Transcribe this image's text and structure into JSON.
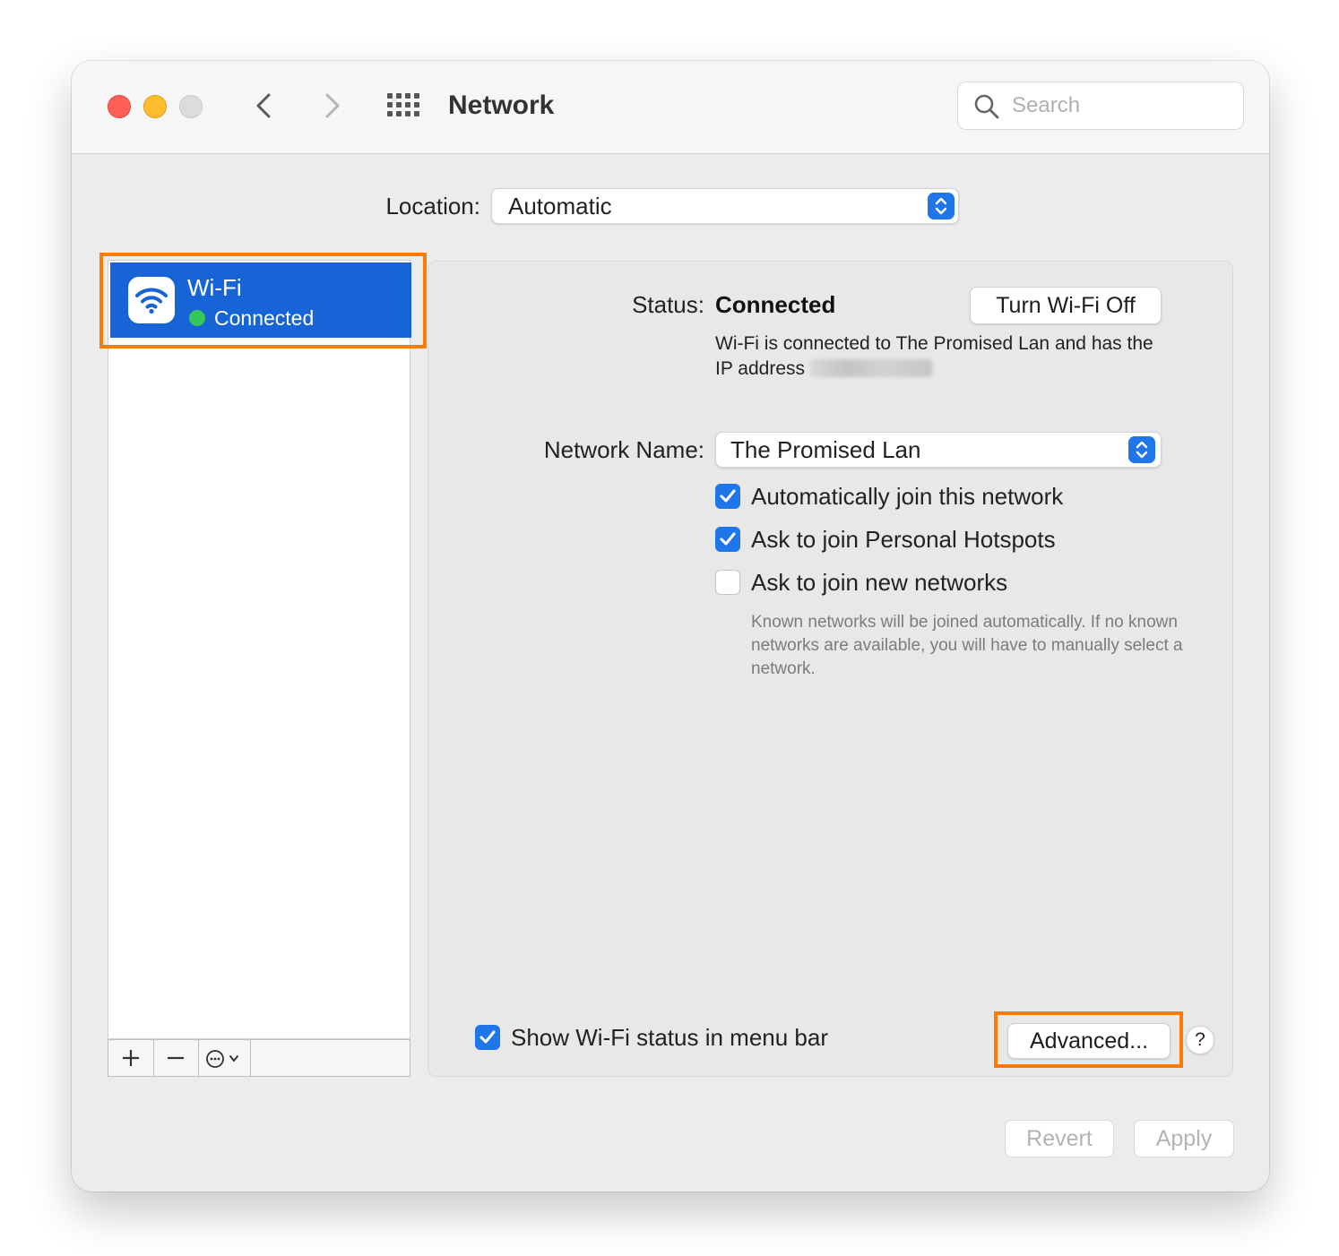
{
  "window": {
    "title": "Network",
    "search": {
      "placeholder": "Search",
      "value": ""
    }
  },
  "location": {
    "label": "Location:",
    "value": "Automatic"
  },
  "sidebar": {
    "items": [
      {
        "name": "Wi-Fi",
        "status": "Connected",
        "icon": "wifi-icon",
        "status_color": "#35c759",
        "selected": true
      }
    ],
    "toolbar": {
      "add_label": "+",
      "remove_label": "−",
      "more_icon": "ellipsis-circle-icon"
    }
  },
  "detail": {
    "status_label": "Status:",
    "status_value": "Connected",
    "turn_off_label": "Turn Wi-Fi Off",
    "status_desc": "Wi-Fi is connected to The Promised Lan and has the IP address",
    "ip_address_redacted": true,
    "network_name_label": "Network Name:",
    "network_name_value": "The Promised Lan",
    "options": [
      {
        "label": "Automatically join this network",
        "checked": true
      },
      {
        "label": "Ask to join Personal Hotspots",
        "checked": true
      },
      {
        "label": "Ask to join new networks",
        "checked": false
      }
    ],
    "hint": "Known networks will be joined automatically. If no known networks are available, you will have to manually select a network.",
    "show_status": {
      "label": "Show Wi-Fi status in menu bar",
      "checked": true
    },
    "advanced_label": "Advanced...",
    "help_label": "?"
  },
  "footer": {
    "revert_label": "Revert",
    "apply_label": "Apply"
  },
  "colors": {
    "accent": "#1e76e8",
    "selection": "#1764d6",
    "highlight": "#ff7a00",
    "connected": "#35c759"
  }
}
